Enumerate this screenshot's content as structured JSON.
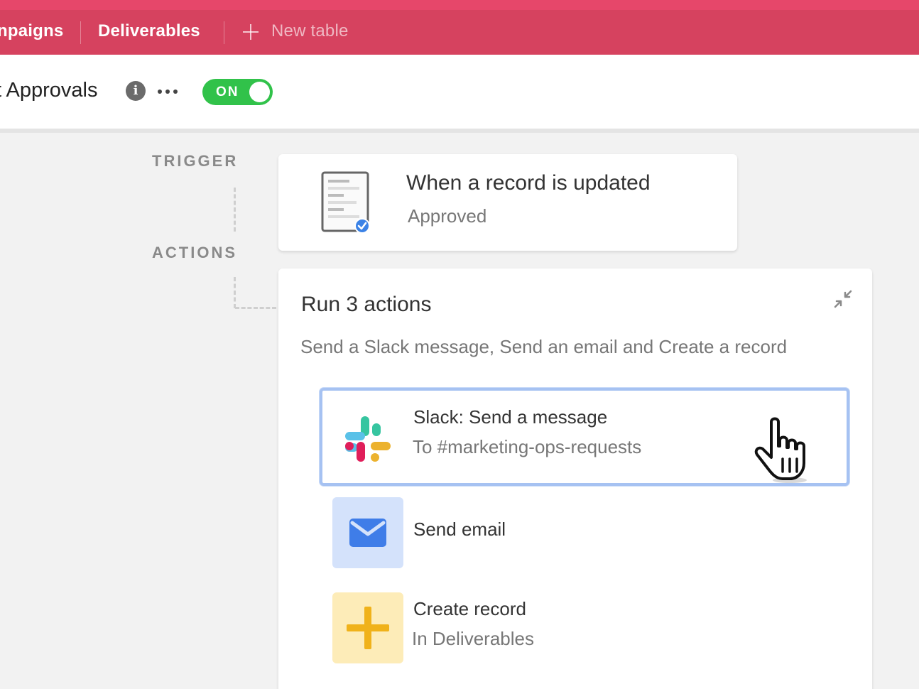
{
  "tabs": {
    "campaigns": "npaigns",
    "deliverables": "Deliverables",
    "new_table": "New table"
  },
  "header": {
    "title": "t Approvals",
    "toggle_label": "ON"
  },
  "rail": {
    "trigger": "TRIGGER",
    "actions": "ACTIONS"
  },
  "trigger": {
    "title": "When a record is updated",
    "subtitle": "Approved"
  },
  "actions": {
    "title": "Run 3 actions",
    "subtitle": "Send a Slack message, Send an email and Create a record",
    "items": [
      {
        "title": "Slack: Send a message",
        "subtitle": "To #marketing-ops-requests",
        "icon": "slack-logo"
      },
      {
        "title": "Send email",
        "subtitle": "",
        "icon": "envelope-icon"
      },
      {
        "title": "Create record",
        "subtitle": "In Deliverables",
        "icon": "plus-icon"
      }
    ]
  },
  "colors": {
    "topbar": "#d6425f",
    "toggle_on": "#31c24a",
    "selection": "#a6c2f2",
    "email_tile": "#d4e2fb",
    "create_tile": "#fdecb8"
  }
}
